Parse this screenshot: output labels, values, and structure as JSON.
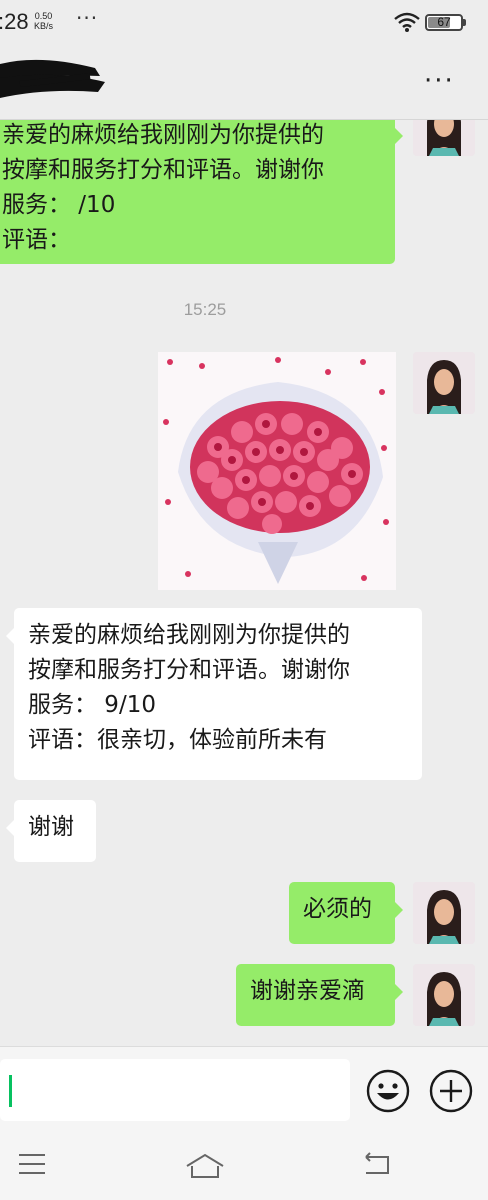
{
  "status_bar": {
    "time": ":28",
    "speed_value": "0.50",
    "speed_unit": "KB/s",
    "dots": "···",
    "battery": "67"
  },
  "nav": {
    "more": "···"
  },
  "messages": [
    {
      "side": "right",
      "lines": [
        "亲爱的麻烦给我刚刚为你提供的",
        "按摩和服务打分和评语。谢谢你",
        "服务：   /10",
        "评语："
      ]
    },
    {
      "type": "time",
      "text": "15:25"
    },
    {
      "side": "right",
      "type": "image",
      "description": "rose-bouquet"
    },
    {
      "side": "left",
      "lines": [
        "亲爱的麻烦给我刚刚为你提供的",
        "按摩和服务打分和评语。谢谢你",
        "服务：  9/10",
        "评语：很亲切，体验前所未有"
      ]
    },
    {
      "side": "left",
      "lines": [
        "谢谢"
      ]
    },
    {
      "side": "right",
      "lines": [
        "必须的"
      ]
    },
    {
      "side": "right",
      "lines": [
        "谢谢亲爱滴"
      ]
    }
  ],
  "colors": {
    "green_bubble": "#95ec69",
    "background": "#ededed",
    "caret": "#07c160"
  },
  "icons": [
    "wifi-icon",
    "battery-icon",
    "more-icon",
    "emoji-icon",
    "plus-icon",
    "menu-icon",
    "home-icon",
    "back-icon"
  ]
}
